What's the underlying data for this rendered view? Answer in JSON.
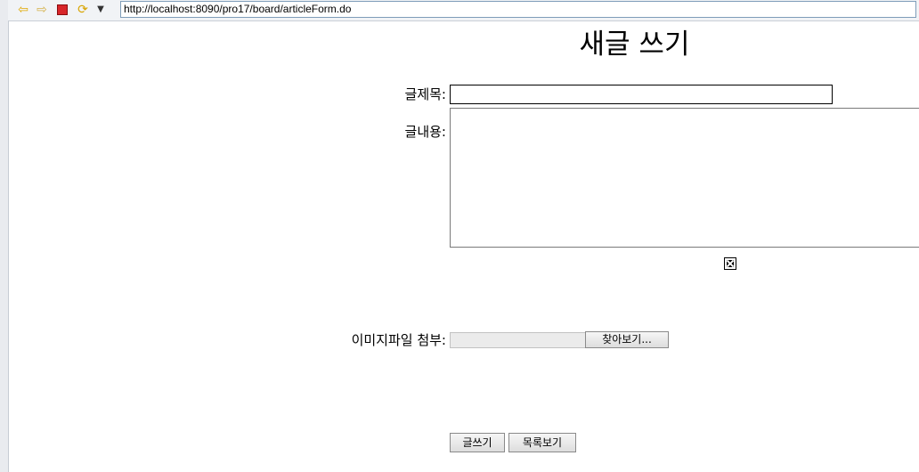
{
  "browser": {
    "url": "http://localhost:8090/pro17/board/articleForm.do",
    "icons": [
      "back-arrow-icon",
      "forward-arrow-icon",
      "stop-icon",
      "refresh-icon",
      "dropdown-icon"
    ]
  },
  "form": {
    "page_title": "새글 쓰기",
    "title_label": "글제목:",
    "title_value": "",
    "content_label": "글내용:",
    "content_value": "",
    "preview_image": "broken-image-icon",
    "file_label": "이미지파일 첨부:",
    "file_button": "찾아보기...",
    "submit_button": "글쓰기",
    "list_button": "목록보기"
  }
}
